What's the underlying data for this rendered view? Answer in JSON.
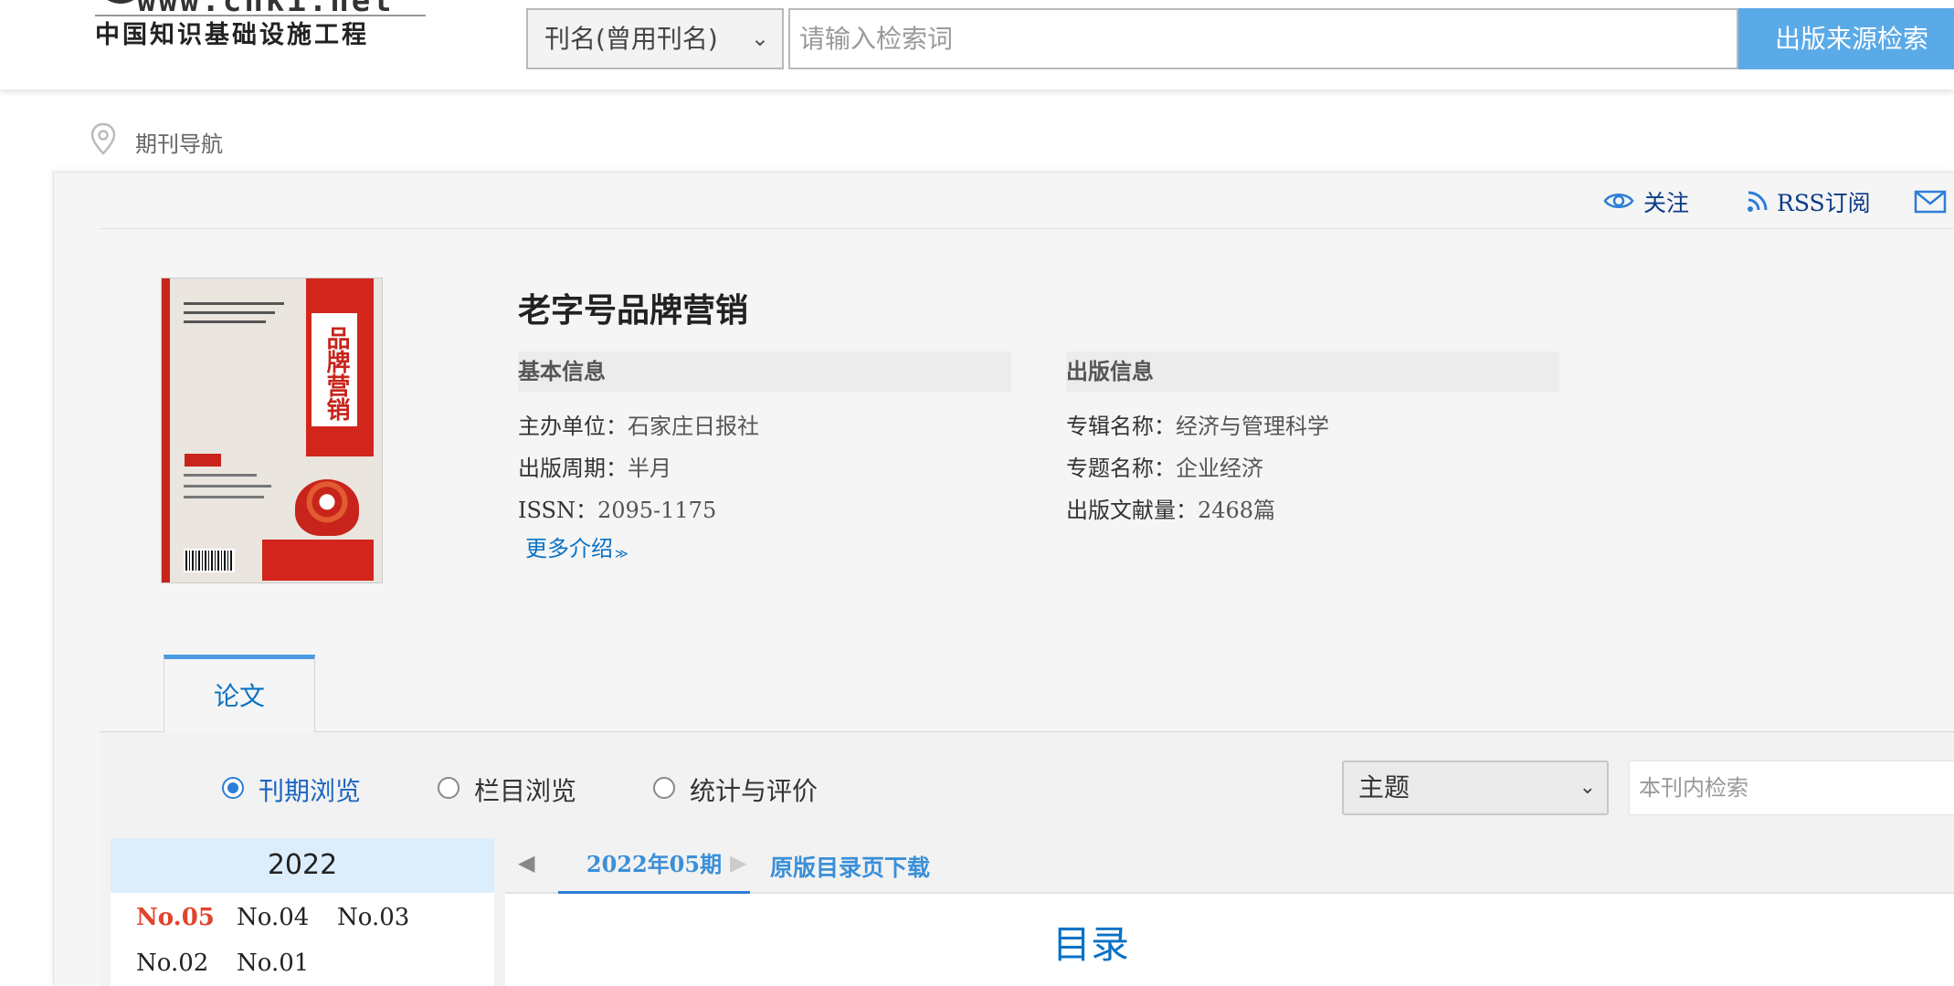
{
  "header": {
    "logo_url": "www.cnki.net",
    "logo_cn": "中国知识基础设施工程",
    "search_type": "刊名(曾用刊名)",
    "search_placeholder": "请输入检索词",
    "search_button": "出版来源检索"
  },
  "breadcrumb": {
    "text": "期刊导航"
  },
  "toolbar": {
    "follow": "关注",
    "rss": "RSS订阅",
    "submit": "投稿"
  },
  "journal": {
    "title": "老字号品牌营销",
    "cover_title": "品牌营销",
    "basic_info": {
      "heading": "基本信息",
      "rows": [
        {
          "key": "主办单位：",
          "value": "石家庄日报社"
        },
        {
          "key": "出版周期：",
          "value": "半月"
        },
        {
          "key": "ISSN：",
          "value": "2095-1175"
        }
      ]
    },
    "publish_info": {
      "heading": "出版信息",
      "rows": [
        {
          "key": "专辑名称：",
          "value": "经济与管理科学"
        },
        {
          "key": "专题名称：",
          "value": "企业经济"
        },
        {
          "key": "出版文献量：",
          "value": "2468篇"
        }
      ]
    },
    "more": "更多介绍"
  },
  "tabs": {
    "papers": "论文"
  },
  "browse": {
    "modes": [
      "刊期浏览",
      "栏目浏览",
      "统计与评价"
    ],
    "selected_mode": "刊期浏览",
    "topic_select": "主题",
    "inner_search_placeholder": "本刊内检索"
  },
  "year_panel": {
    "year": "2022",
    "issues": [
      "No.05",
      "No.04",
      "No.03",
      "No.02",
      "No.01"
    ],
    "current": "No.05"
  },
  "issue_nav": {
    "current_issue": "2022年05期",
    "download": "原版目录页下载"
  },
  "toc": {
    "title": "目录"
  },
  "colors": {
    "accent_blue": "#5baae8",
    "link_blue": "#0a72c4",
    "current_issue_red": "#e0452e",
    "year_header_bg": "#dceefc"
  }
}
